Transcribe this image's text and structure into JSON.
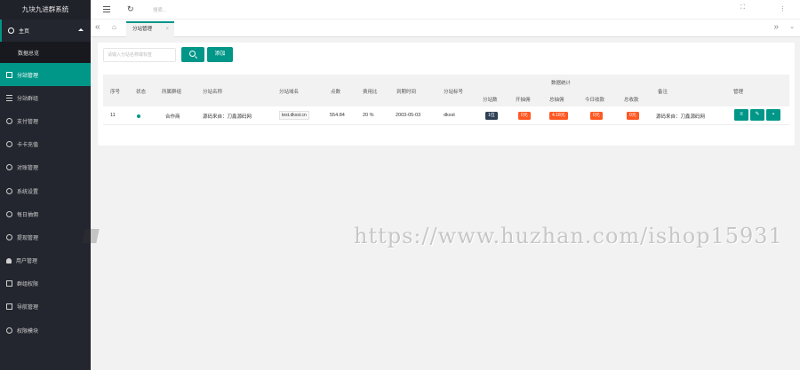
{
  "app_title": "九块九进群系统",
  "colors": {
    "accent": "#009688",
    "sidebar_bg": "#23262e",
    "badge_red": "#ff5722",
    "badge_dark": "#2f4056"
  },
  "sidebar": {
    "home": {
      "label": "主页",
      "icon": "home-icon"
    },
    "home_sub": {
      "label": "数据总览"
    },
    "items": [
      {
        "label": "分站管理",
        "icon": "grid-icon",
        "active": true
      },
      {
        "label": "分站群组",
        "icon": "bars-icon"
      },
      {
        "label": "支付管理",
        "icon": "check-circle-icon"
      },
      {
        "label": "卡卡充值",
        "icon": "circle-icon"
      },
      {
        "label": "对账管理",
        "icon": "check-circle-icon"
      },
      {
        "label": "系统设置",
        "icon": "check-circle-icon"
      },
      {
        "label": "每日抽佣",
        "icon": "check-circle-icon"
      },
      {
        "label": "提现管理",
        "icon": "circle-icon"
      },
      {
        "label": "用户管理",
        "icon": "user-icon"
      },
      {
        "label": "群组权限",
        "icon": "grid-icon"
      },
      {
        "label": "导航管理",
        "icon": "grid-icon"
      },
      {
        "label": "权限模块",
        "icon": "circle-icon"
      }
    ]
  },
  "topbar": {
    "search_placeholder": "搜索..."
  },
  "tabs": {
    "current": "分站管理",
    "close": "×"
  },
  "toolbar": {
    "search_placeholder": "请输入分站名称或标签",
    "add_label": "添加"
  },
  "table": {
    "headers": {
      "id": "序号",
      "status": "状态",
      "group": "所属群组",
      "name": "分站名称",
      "domain": "分站域名",
      "points": "点数",
      "rate": "费用比",
      "expire": "到期时间",
      "tag": "分站标号",
      "stats_group": "数据统计",
      "count": "分站数",
      "commission": "开抽佣",
      "total_commission": "总抽佣",
      "today_income": "今日收款",
      "total_income": "总收款",
      "remark": "备注",
      "manage": "管理"
    },
    "rows": [
      {
        "id": "11",
        "group": "合作商",
        "name": "源码来自：刀鑫源码网",
        "domain": "test.dkxst.cn",
        "points": "554.84",
        "rate": "20 %",
        "expire": "2003-05-03",
        "tag": "dkxst",
        "count": "1位",
        "commission": "0元",
        "total_commission": "4.18元",
        "today_income": "0元",
        "total_income": "0元",
        "remark": "源码来自：刀鑫源码网"
      }
    ]
  },
  "watermark": "https://www.huzhan.com/ishop15931"
}
